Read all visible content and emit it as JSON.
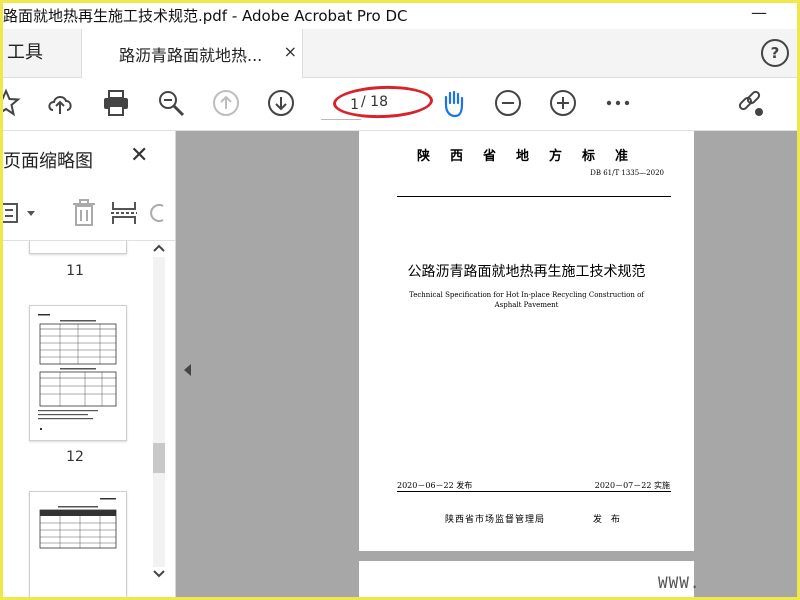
{
  "window": {
    "title": "路面就地热再生施工技术规范.pdf - Adobe Acrobat Pro DC",
    "minimize_glyph": "—"
  },
  "tabs": {
    "tools_label": "工具",
    "document_label": "路沥青路面就地热...",
    "close_glyph": "×",
    "help_glyph": "?"
  },
  "toolbar": {
    "page_current": "1",
    "page_total": "/ 18",
    "icons": [
      "star-icon",
      "upload-icon",
      "print-icon",
      "zoom-search-icon",
      "page-up-icon",
      "page-down-icon",
      "hand-tool-icon",
      "zoom-out-icon",
      "zoom-in-icon",
      "more-icon",
      "share-link-icon"
    ]
  },
  "panel": {
    "title": "页面缩略图",
    "close_glyph": "✕",
    "thumbnails": [
      {
        "number": "11"
      },
      {
        "number": "12"
      },
      {
        "number": ""
      }
    ]
  },
  "document": {
    "header": "陕西省地方标准",
    "code": "DB 61/T 1335—2020",
    "title_cn": "公路沥青路面就地热再生施工技术规范",
    "title_en": "Technical Specification for Hot In-place Recycling Construction of Asphalt Pavement",
    "publish_date": "2020－06－22 发布",
    "implement_date": "2020－07－22 实施",
    "issuer": "陕西省市场监督管理局",
    "issue_word": "发 布"
  },
  "watermark": "WWW.",
  "colors": {
    "accent_blue": "#1a73e8",
    "annotation_red": "#d8232a",
    "frame_yellow": "#f0e84a"
  }
}
